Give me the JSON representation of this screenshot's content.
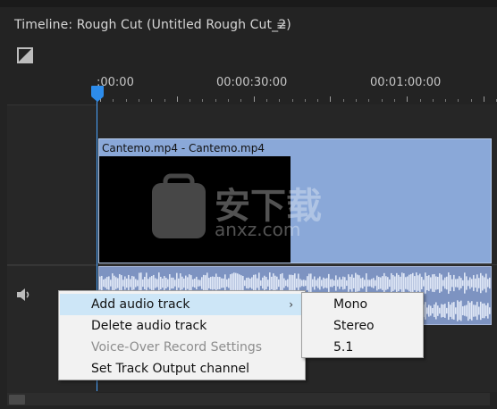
{
  "panel": {
    "title": "Timeline: Rough Cut (Untitled Rough Cut_2)",
    "menu_icon": "≡"
  },
  "ruler": {
    "timecodes": [
      ":00:00",
      "00:00:30:00",
      "00:01:00:00"
    ]
  },
  "video_track": {
    "clip_label": "Cantemo.mp4 - Cantemo.mp4"
  },
  "context_menu": {
    "items": [
      {
        "label": "Add audio track",
        "has_submenu": true,
        "highlighted": true,
        "disabled": false
      },
      {
        "label": "Delete audio track",
        "has_submenu": false,
        "highlighted": false,
        "disabled": false
      },
      {
        "label": "Voice-Over Record Settings",
        "has_submenu": false,
        "highlighted": false,
        "disabled": true
      },
      {
        "label": "Set Track Output channel",
        "has_submenu": false,
        "highlighted": false,
        "disabled": false
      }
    ],
    "submenu_arrow": "›"
  },
  "submenu": {
    "items": [
      "Mono",
      "Stereo",
      "5.1"
    ]
  },
  "colors": {
    "playhead": "#2d8ceb",
    "video_clip": "#8aa8d8",
    "audio_clip": "#7d93c1",
    "menu_highlight": "#cde6f7"
  },
  "watermark": {
    "text_cn": "安下载",
    "text_en": "anxz.com"
  }
}
